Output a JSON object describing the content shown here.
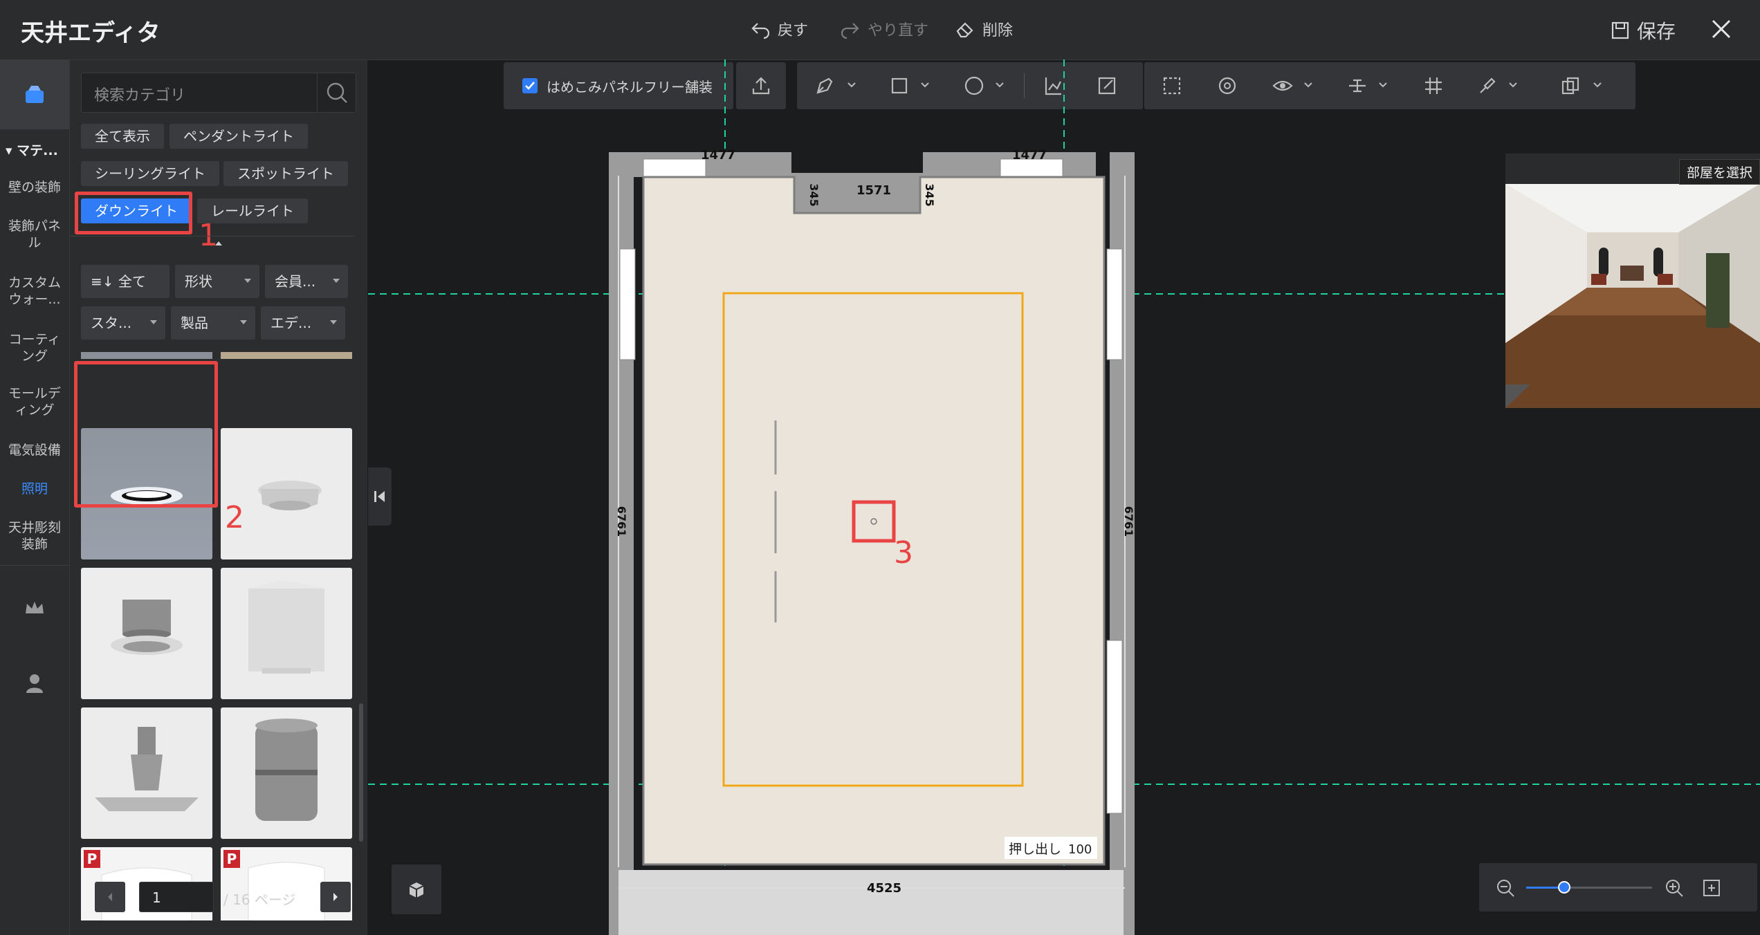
{
  "window": {
    "title": "天井エディタ",
    "undo_label": "戻す",
    "redo_label": "やり直す",
    "delete_label": "削除",
    "save_label": "保存"
  },
  "rail": {
    "section_label": "マテ...",
    "items": [
      {
        "label": "壁の装飾",
        "active": false
      },
      {
        "label": "装飾パネル",
        "active": false
      },
      {
        "label": "カスタムウォー...",
        "active": false
      },
      {
        "label": "コーティング",
        "active": false
      },
      {
        "label": "モールディング",
        "active": false
      },
      {
        "label": "電気設備",
        "active": false
      },
      {
        "label": "照明",
        "active": true
      },
      {
        "label": "天井彫刻装飾",
        "active": false
      }
    ]
  },
  "catalog": {
    "search_placeholder": "検索カテゴリ",
    "categories": [
      "全て表示",
      "ペンダントライト",
      "シーリングライト",
      "スポットライト",
      "ダウンライト",
      "レールライト"
    ],
    "active_category": "ダウンライト",
    "filters": [
      "全て",
      "形状",
      "会員...",
      "スタ...",
      "製品",
      "エデ..."
    ],
    "pager": {
      "current": "1",
      "total_text": "/ 16 ページ"
    }
  },
  "toolbar": {
    "checkbox_label": "はめこみパネルフリー舗装",
    "checkbox_checked": true
  },
  "plan": {
    "dim_top_left": "1477",
    "dim_top_right": "1477",
    "dim_niche_width": "1571",
    "dim_niche_left": "345",
    "dim_niche_right": "345",
    "dim_left_side": "6761",
    "dim_right_side": "6761",
    "dim_bottom": "4525",
    "extrude_label": "押し出し",
    "extrude_value": "100"
  },
  "annotations": {
    "label_1": "1",
    "label_2": "2",
    "label_3": "3"
  },
  "preview": {
    "select_room_label": "部屋を選択"
  },
  "zoom": {
    "level": 0.3
  },
  "colors": {
    "accent": "#2f7cf6",
    "guide_line": "#1fd3a0",
    "selection_orange": "#f0a81a",
    "highlight_red": "#e84444"
  }
}
